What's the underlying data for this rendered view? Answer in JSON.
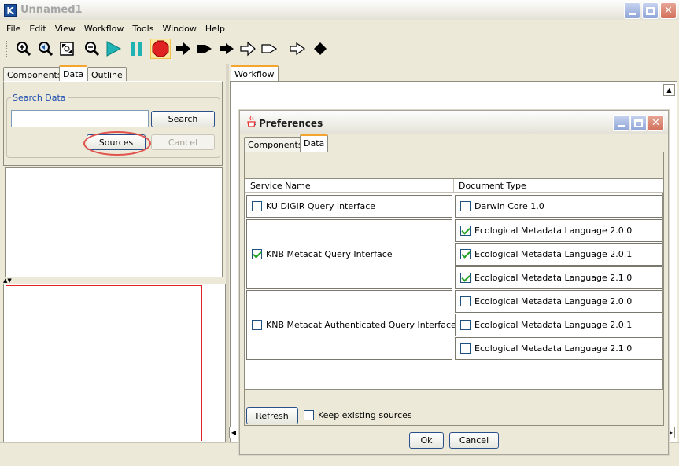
{
  "app": {
    "title": "Unnamed1",
    "logo_letter": "K"
  },
  "menu": [
    "File",
    "Edit",
    "View",
    "Workflow",
    "Tools",
    "Window",
    "Help"
  ],
  "toolbar": {
    "icons": [
      "zoom-in-icon",
      "zoom-reset-icon",
      "fit-icon",
      "zoom-out-icon",
      "run-icon",
      "pause-icon",
      "stop-icon",
      "arrow-icon",
      "arrow-icon",
      "arrow-icon",
      "arrow-icon",
      "arrow-icon",
      "arrow-icon",
      "diamond-icon"
    ]
  },
  "left_panel": {
    "tabs": [
      "Components",
      "Data",
      "Outline"
    ],
    "search_legend": "Search Data",
    "search_value": "",
    "search_button": "Search",
    "sources_button": "Sources",
    "cancel_button": "Cancel"
  },
  "workflow_tab": "Workflow",
  "dialog": {
    "title": "Preferences",
    "tabs": [
      "Components",
      "Data"
    ],
    "columns": [
      "Service Name",
      "Document Type"
    ],
    "services": [
      {
        "name": "KU DiGIR Query Interface",
        "checked": false,
        "docs": [
          {
            "label": "Darwin Core 1.0",
            "checked": false
          }
        ]
      },
      {
        "name": "KNB Metacat Query Interface",
        "checked": true,
        "docs": [
          {
            "label": "Ecological Metadata Language 2.0.0",
            "checked": true
          },
          {
            "label": "Ecological Metadata Language 2.0.1",
            "checked": true
          },
          {
            "label": "Ecological Metadata Language 2.1.0",
            "checked": true
          }
        ]
      },
      {
        "name": "KNB Metacat Authenticated Query Interface",
        "checked": false,
        "docs": [
          {
            "label": "Ecological Metadata Language 2.0.0",
            "checked": false
          },
          {
            "label": "Ecological Metadata Language 2.0.1",
            "checked": false
          },
          {
            "label": "Ecological Metadata Language 2.1.0",
            "checked": false
          }
        ]
      }
    ],
    "refresh_button": "Refresh",
    "keep_sources_label": "Keep existing sources",
    "keep_sources_checked": false,
    "ok_button": "Ok",
    "cancel_button": "Cancel"
  }
}
